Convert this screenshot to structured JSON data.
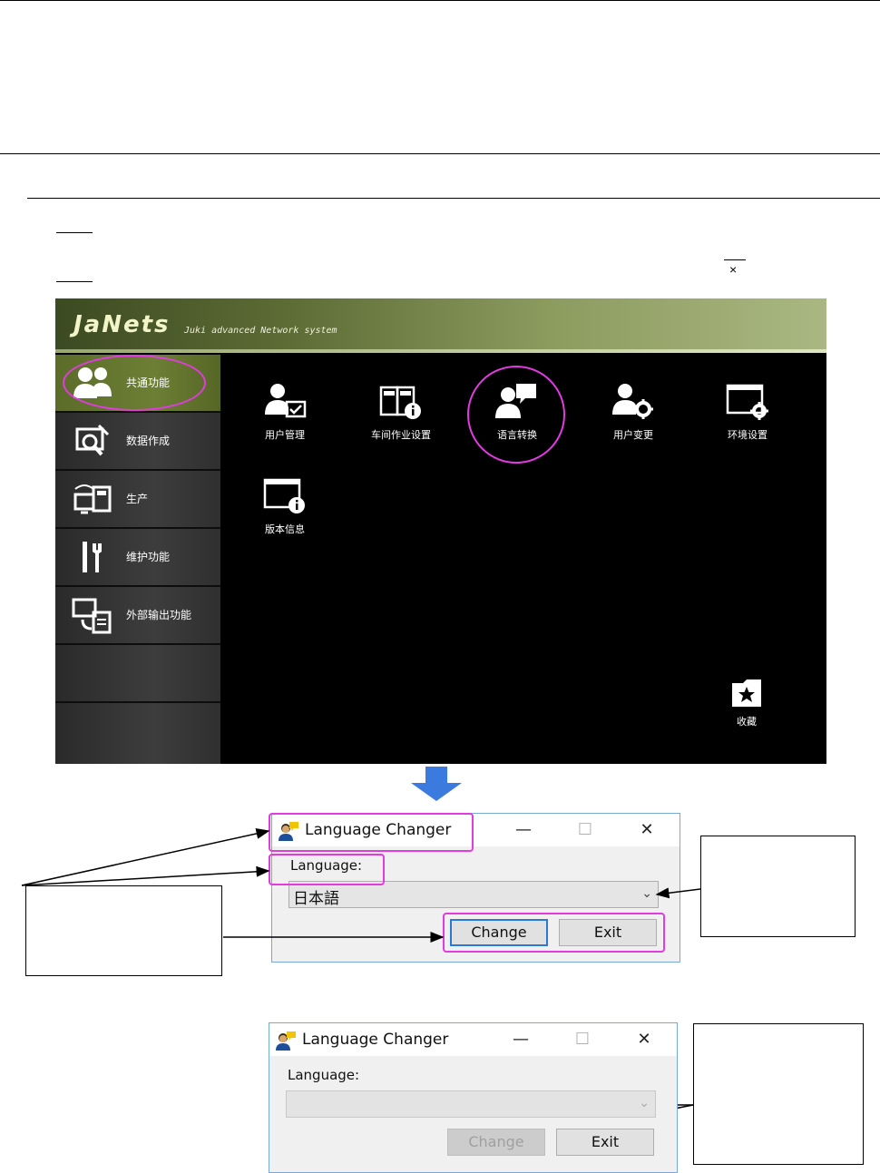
{
  "top_window_close": "×",
  "janets": {
    "logo": "JaNets",
    "subtitle": "Juki advanced Network system",
    "sidebar": [
      {
        "icon": "users-icon",
        "label": "共通功能",
        "active": true
      },
      {
        "icon": "data-create-icon",
        "label": "数据作成",
        "active": false
      },
      {
        "icon": "production-icon",
        "label": "生产",
        "active": false
      },
      {
        "icon": "maintenance-icon",
        "label": "维护功能",
        "active": false
      },
      {
        "icon": "external-output-icon",
        "label": "外部输出功能",
        "active": false
      },
      {
        "icon": "",
        "label": "",
        "active": false
      },
      {
        "icon": "",
        "label": "",
        "active": false
      }
    ],
    "tiles": [
      {
        "icon": "user-management-icon",
        "label": "用户管理"
      },
      {
        "icon": "workshop-settings-icon",
        "label": "车间作业设置"
      },
      {
        "icon": "language-switch-icon",
        "label": "语言转换"
      },
      {
        "icon": "user-change-icon",
        "label": "用户变更"
      },
      {
        "icon": "environment-settings-icon",
        "label": "环境设置"
      },
      {
        "icon": "version-info-icon",
        "label": "版本信息"
      }
    ],
    "favorites_label": "收藏"
  },
  "dialog1": {
    "title": "Language Changer",
    "minimize": "—",
    "maximize": "☐",
    "close": "✕",
    "language_label": "Language:",
    "selected_language": "日本語",
    "change_button": "Change",
    "exit_button": "Exit"
  },
  "dialog2": {
    "title": "Language Changer",
    "minimize": "—",
    "maximize": "☐",
    "close": "✕",
    "language_label": "Language:",
    "selected_language": "",
    "change_button": "Change",
    "exit_button": "Exit"
  },
  "colors": {
    "highlight": "#e23be0",
    "sidebar_active": "#6d7f34",
    "dialog_border": "#7aa9d6",
    "arrow_blue": "#3b7be0"
  }
}
